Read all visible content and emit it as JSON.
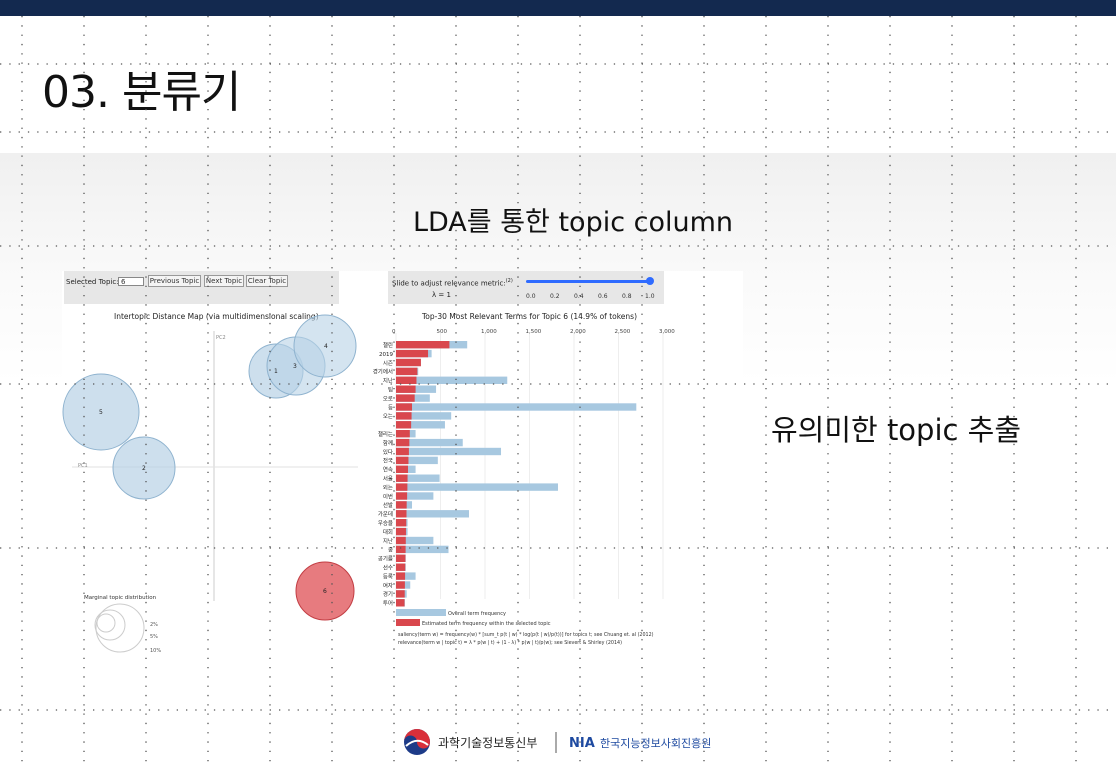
{
  "slide": {
    "title": "03. 분류기",
    "subtitle": "LDA를 통한 topic column",
    "side_note": "유의미한 topic 추출"
  },
  "ldavis": {
    "selected_topic_label": "Selected Topic:",
    "selected_topic_value": "6",
    "prev_button": "Previous Topic",
    "next_button": "Next Topic",
    "clear_button": "Clear Topic",
    "slider_label": "Slide to adjust relevance metric:",
    "slider_superscript": "(2)",
    "lambda_label": "λ = 1",
    "lambda_value": 1,
    "slider_ticks": [
      "0.0",
      "0.2",
      "0.4",
      "0.6",
      "0.8",
      "1.0"
    ],
    "map_title": "Intertopic Distance Map (via multidimensional scaling)",
    "pc1_label": "PC1",
    "pc2_label": "PC2",
    "marginal_title": "Marginal topic distribution",
    "marginal_ticks": [
      "2%",
      "5%",
      "10%"
    ],
    "topics": [
      {
        "id": "1",
        "selected": false
      },
      {
        "id": "2",
        "selected": false
      },
      {
        "id": "3",
        "selected": false
      },
      {
        "id": "4",
        "selected": false
      },
      {
        "id": "5",
        "selected": false
      },
      {
        "id": "6",
        "selected": true
      }
    ],
    "legend_overall": "Overall term frequency",
    "legend_estimated": "Estimated term frequency within the selected topic",
    "footnote_1": "saliency(term w) = frequency(w) * [sum_t p(t | w) * log(p(t | w)/p(t))] for topics t; see Chuang et. al (2012)",
    "footnote_2": "relevance(term w | topic t) = λ * p(w | t) + (1 - λ) * p(w | t)/p(w); see Sievert & Shirley (2014)"
  },
  "chart_data": {
    "type": "bar",
    "title": "Top-30 Most Relevant Terms for Topic 6 (14.9% of tokens)",
    "xlim": [
      0,
      3000
    ],
    "x_ticks": [
      "0",
      "500",
      "1,000",
      "1,500",
      "2,000",
      "2,500",
      "3,000"
    ],
    "categories": [
      "챌린",
      "2019",
      "시즌",
      "경기에서",
      "지난",
      "팀",
      "오로",
      "등",
      "오는",
      "",
      "챌리는",
      "함께",
      "있다",
      "전국",
      "연속",
      "서울",
      "외는",
      "이번",
      "선발",
      "가운데",
      "우승을",
      "대회",
      "지난",
      "중",
      "공기를",
      "선수",
      "등록",
      "여자",
      "경기",
      "투어"
    ],
    "series": [
      {
        "name": "Overall term frequency",
        "color": "#a7c8e0",
        "values": [
          800,
          400,
          280,
          250,
          1250,
          450,
          380,
          2700,
          620,
          550,
          220,
          750,
          1180,
          470,
          220,
          490,
          1820,
          420,
          180,
          820,
          130,
          130,
          420,
          590,
          110,
          110,
          220,
          160,
          120,
          100
        ]
      },
      {
        "name": "Estimated term frequency within the selected topic",
        "color": "#d9474d",
        "values": [
          600,
          360,
          280,
          240,
          230,
          220,
          210,
          180,
          175,
          170,
          155,
          150,
          145,
          140,
          135,
          130,
          128,
          125,
          120,
          118,
          115,
          112,
          110,
          108,
          106,
          104,
          102,
          100,
          98,
          96
        ]
      }
    ]
  },
  "footer": {
    "ministry": "과학기술정보통신부",
    "agency_abbr": "NIA",
    "agency": "한국지능정보사회진흥원"
  },
  "colors": {
    "top_bar": "#13294f",
    "topic_circle": "#b8d2e6",
    "selected_topic_circle": "#e15a5f",
    "nia_blue": "#1e4aa0"
  }
}
